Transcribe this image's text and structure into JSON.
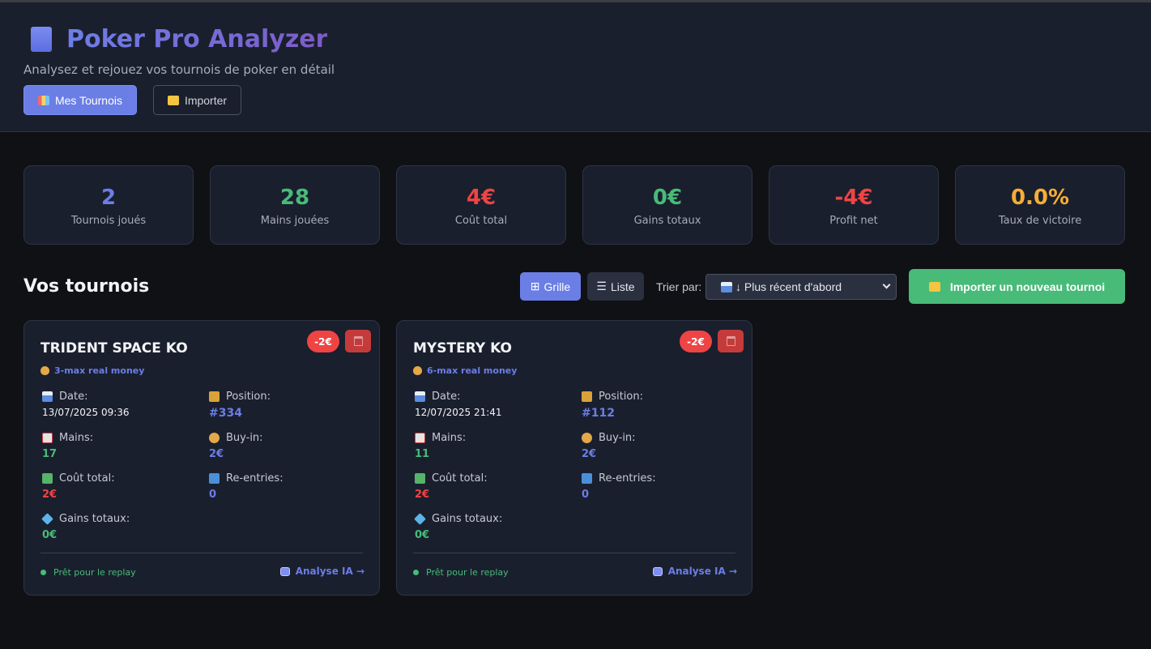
{
  "header": {
    "title": "Poker Pro Analyzer",
    "subtitle": "Analysez et rejouez vos tournois de poker en détail",
    "btn_tournois": "Mes Tournois",
    "btn_import": "Importer"
  },
  "stats": [
    {
      "value": "2",
      "label": "Tournois joués",
      "color": "#6b7ee6"
    },
    {
      "value": "28",
      "label": "Mains jouées",
      "color": "#48bb78"
    },
    {
      "value": "4€",
      "label": "Coût total",
      "color": "#ef4444"
    },
    {
      "value": "0€",
      "label": "Gains totaux",
      "color": "#48bb78"
    },
    {
      "value": "-4€",
      "label": "Profit net",
      "color": "#ef4444"
    },
    {
      "value": "0.0%",
      "label": "Taux de victoire",
      "color": "#f6ad35"
    }
  ],
  "section": {
    "title": "Vos tournois",
    "btn_grille": "Grille",
    "btn_liste": "Liste",
    "sort_label": "Trier par:",
    "sort_value": "↓ Plus récent d'abord",
    "btn_import_new": "Importer un nouveau tournoi"
  },
  "labels": {
    "date": "Date:",
    "position": "Position:",
    "mains": "Mains:",
    "buyin": "Buy-in:",
    "cout": "Coût total:",
    "reentries": "Re-entries:",
    "gains": "Gains totaux:",
    "ready": "Prêt pour le replay",
    "analyse": "Analyse IA →"
  },
  "tournaments": [
    {
      "name": "TRIDENT SPACE KO",
      "format": "3-max real money",
      "badge": "-2€",
      "date": "13/07/2025 09:36",
      "position": "#334",
      "mains": "17",
      "buyin": "2€",
      "cout": "2€",
      "reentries": "0",
      "gains": "0€"
    },
    {
      "name": "MYSTERY KO",
      "format": "6-max real money",
      "badge": "-2€",
      "date": "12/07/2025 21:41",
      "position": "#112",
      "mains": "11",
      "buyin": "2€",
      "cout": "2€",
      "reentries": "0",
      "gains": "0€"
    }
  ],
  "icons": {
    "logo": "book-icon",
    "chart": "bar-chart-icon",
    "folder": "folder-icon",
    "calendar": "calendar-icon",
    "trophy": "trophy-icon",
    "cards": "playing-card-icon",
    "money": "money-bag-icon",
    "flying_money": "money-wings-icon",
    "repeat": "repeat-icon",
    "gem": "gem-icon",
    "trash": "trash-icon",
    "robot": "robot-icon"
  }
}
